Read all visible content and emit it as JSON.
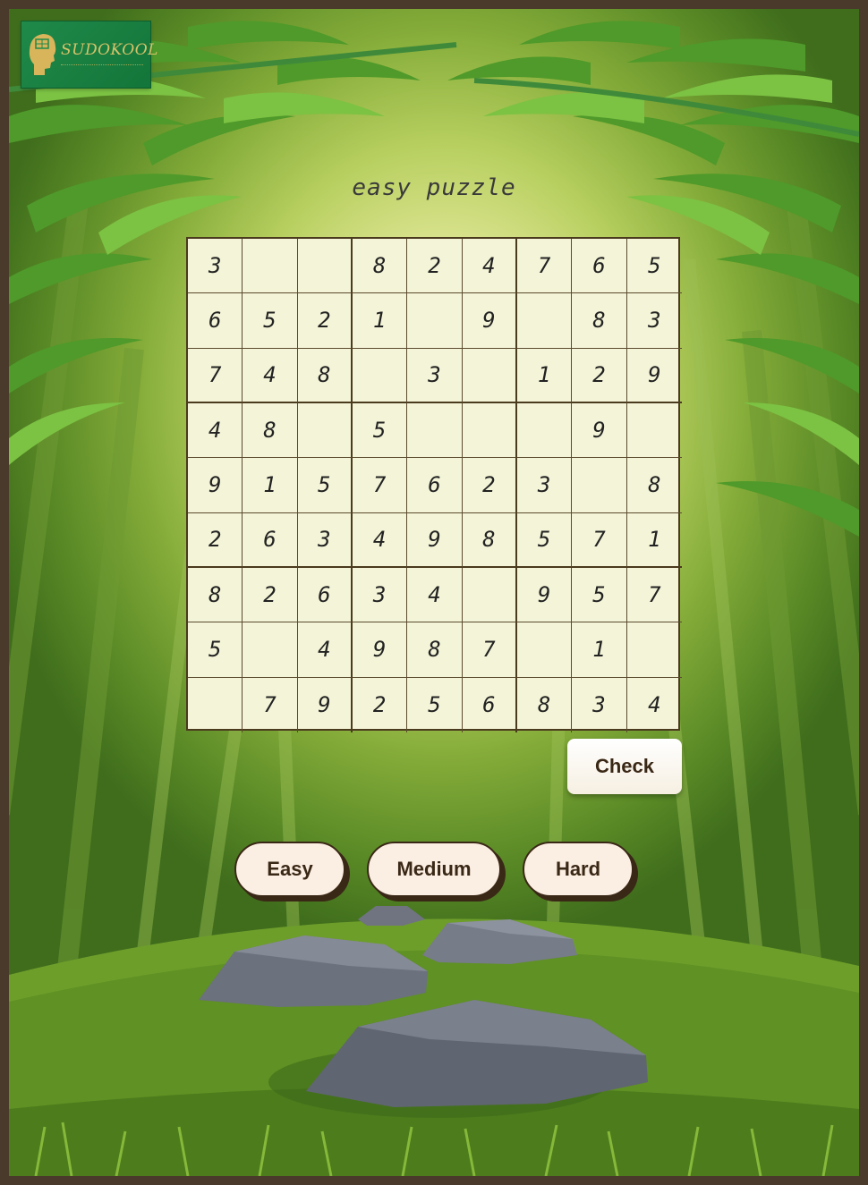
{
  "logo": {
    "text": "SUDOKOOL"
  },
  "puzzle": {
    "title": "easy puzzle",
    "grid": [
      [
        "3",
        "",
        "",
        "8",
        "2",
        "4",
        "7",
        "6",
        "5"
      ],
      [
        "6",
        "5",
        "2",
        "1",
        "",
        "9",
        "",
        "8",
        "3"
      ],
      [
        "7",
        "4",
        "8",
        "",
        "3",
        "",
        "1",
        "2",
        "9"
      ],
      [
        "4",
        "8",
        "",
        "5",
        "",
        "",
        "",
        "9",
        ""
      ],
      [
        "9",
        "1",
        "5",
        "7",
        "6",
        "2",
        "3",
        "",
        "8"
      ],
      [
        "2",
        "6",
        "3",
        "4",
        "9",
        "8",
        "5",
        "7",
        "1"
      ],
      [
        "8",
        "2",
        "6",
        "3",
        "4",
        "",
        "9",
        "5",
        "7"
      ],
      [
        "5",
        "",
        "4",
        "9",
        "8",
        "7",
        "",
        "1",
        ""
      ],
      [
        "",
        "7",
        "9",
        "2",
        "5",
        "6",
        "8",
        "3",
        "4"
      ]
    ]
  },
  "check_label": "Check",
  "difficulty": [
    "Easy",
    "Medium",
    "Hard"
  ],
  "colors": {
    "frame": "#4a3a2c",
    "cell_bg": "#f4f4d8",
    "button_bg": "#fbeee2",
    "text_dark": "#3a2816",
    "logo_green": "#1f8a4a"
  }
}
